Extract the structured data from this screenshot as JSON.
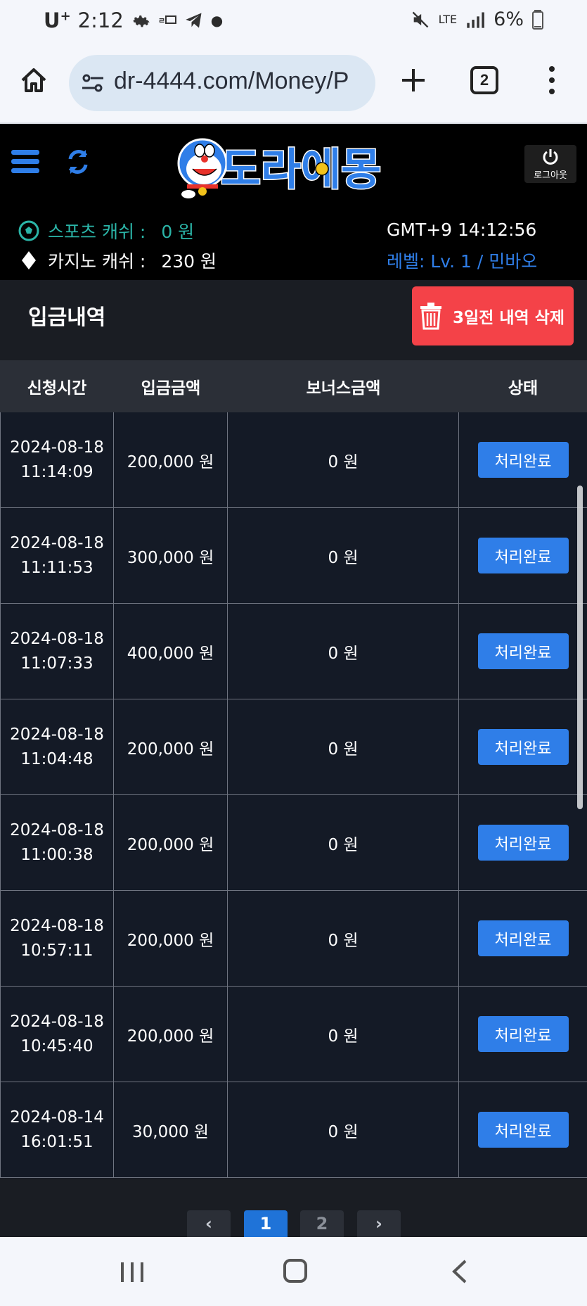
{
  "status_bar": {
    "carrier": "U",
    "carrier_sup": "+",
    "time": "2:12",
    "network": "LTE",
    "battery": "6%"
  },
  "browser": {
    "url": "dr-4444.com/Money/P",
    "tab_count": "2"
  },
  "header": {
    "logo_text": "도라에몽",
    "logout_label": "로그아웃",
    "sports_label": "스포츠 캐쉬 :",
    "sports_value": "0 원",
    "casino_label": "카지노 캐쉬 :",
    "casino_value": "230 원",
    "clock": "GMT+9 14:12:56",
    "level": "레벨: Lv. 1 / 민바오"
  },
  "section": {
    "title": "입금내역",
    "delete_button": "3일전 내역 삭제"
  },
  "table": {
    "columns": [
      "신청시간",
      "입금금액",
      "보너스금액",
      "상태"
    ],
    "rows": [
      {
        "date": "2024-08-18",
        "time": "11:14:09",
        "amount": "200,000 원",
        "bonus": "0 원",
        "status": "처리완료"
      },
      {
        "date": "2024-08-18",
        "time": "11:11:53",
        "amount": "300,000 원",
        "bonus": "0 원",
        "status": "처리완료"
      },
      {
        "date": "2024-08-18",
        "time": "11:07:33",
        "amount": "400,000 원",
        "bonus": "0 원",
        "status": "처리완료"
      },
      {
        "date": "2024-08-18",
        "time": "11:04:48",
        "amount": "200,000 원",
        "bonus": "0 원",
        "status": "처리완료"
      },
      {
        "date": "2024-08-18",
        "time": "11:00:38",
        "amount": "200,000 원",
        "bonus": "0 원",
        "status": "처리완료"
      },
      {
        "date": "2024-08-18",
        "time": "10:57:11",
        "amount": "200,000 원",
        "bonus": "0 원",
        "status": "처리완료"
      },
      {
        "date": "2024-08-18",
        "time": "10:45:40",
        "amount": "200,000 원",
        "bonus": "0 원",
        "status": "처리완료"
      },
      {
        "date": "2024-08-14",
        "time": "16:01:51",
        "amount": "30,000 원",
        "bonus": "0 원",
        "status": "처리완료"
      }
    ]
  },
  "pagination": {
    "prev": "‹",
    "pages": [
      "1",
      "2"
    ],
    "next": "›"
  },
  "colors": {
    "accent_blue": "#2f7ee8",
    "delete_red": "#f44248",
    "sports_teal": "#2bb5a8"
  }
}
